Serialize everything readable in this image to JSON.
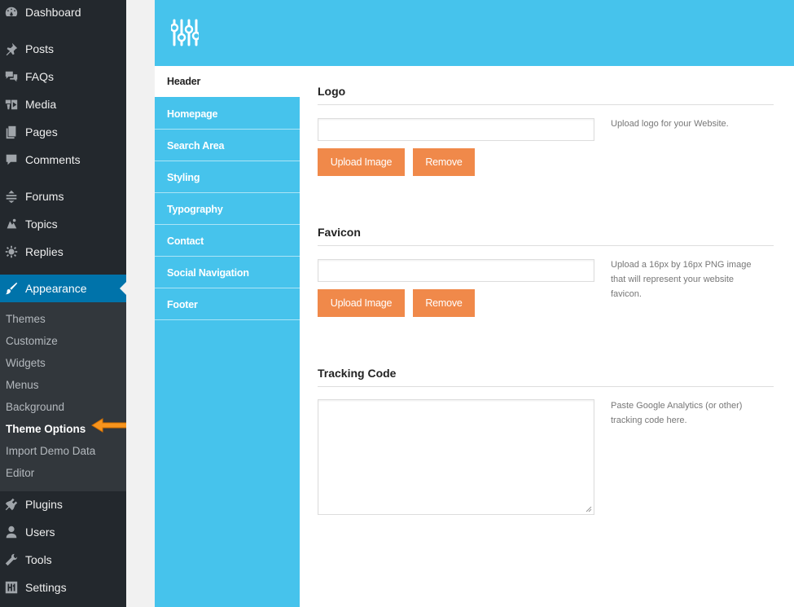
{
  "admin_menu": {
    "items": [
      {
        "label": "Dashboard",
        "icon": "dashboard-icon"
      },
      {
        "label": "Posts",
        "icon": "pushpin-icon"
      },
      {
        "label": "FAQs",
        "icon": "chat-bubbles-icon"
      },
      {
        "label": "Media",
        "icon": "media-icon"
      },
      {
        "label": "Pages",
        "icon": "pages-icon"
      },
      {
        "label": "Comments",
        "icon": "comment-icon"
      },
      {
        "label": "Forums",
        "icon": "forums-icon"
      },
      {
        "label": "Topics",
        "icon": "topics-icon"
      },
      {
        "label": "Replies",
        "icon": "replies-icon"
      },
      {
        "label": "Appearance",
        "icon": "paintbrush-icon"
      },
      {
        "label": "Plugins",
        "icon": "plugin-icon"
      },
      {
        "label": "Users",
        "icon": "user-icon"
      },
      {
        "label": "Tools",
        "icon": "wrench-icon"
      },
      {
        "label": "Settings",
        "icon": "settings-sliders-icon"
      }
    ],
    "current": "Appearance",
    "submenu": [
      "Themes",
      "Customize",
      "Widgets",
      "Menus",
      "Background",
      "Theme Options",
      "Import Demo Data",
      "Editor"
    ],
    "submenu_active": "Theme Options"
  },
  "options_panel": {
    "logo_icon": "sliders-icon",
    "tabs": [
      "Header",
      "Homepage",
      "Search Area",
      "Styling",
      "Typography",
      "Contact",
      "Social Navigation",
      "Footer"
    ],
    "active_tab": "Header",
    "sections": {
      "logo": {
        "title": "Logo",
        "value": "",
        "upload_label": "Upload Image",
        "remove_label": "Remove",
        "help": "Upload logo for your Website."
      },
      "favicon": {
        "title": "Favicon",
        "value": "",
        "upload_label": "Upload Image",
        "remove_label": "Remove",
        "help": "Upload a 16px by 16px PNG image that will represent your website favicon."
      },
      "tracking": {
        "title": "Tracking Code",
        "value": "",
        "help": "Paste Google Analytics (or other) tracking code here."
      }
    }
  },
  "colors": {
    "sidebar_bg": "#23282d",
    "submenu_bg": "#32373c",
    "current_item_bg": "#0073aa",
    "panel_accent": "#46c3ec",
    "button_orange": "#f0894a",
    "pointer_arrow": "#f7941d"
  }
}
